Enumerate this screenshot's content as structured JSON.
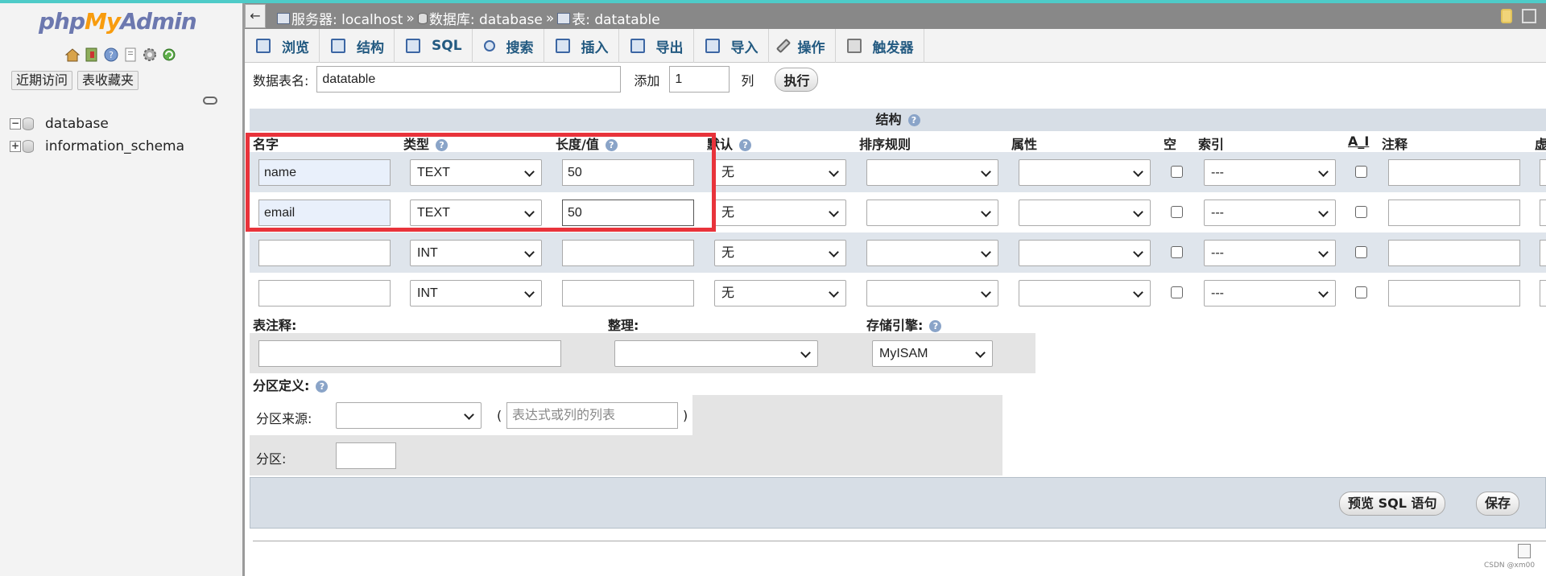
{
  "nav": {
    "logo_php": "php",
    "logo_my": "My",
    "logo_admin": "Admin",
    "icons": [
      "home-icon",
      "exit-icon",
      "help-icon",
      "docs-icon",
      "settings-icon",
      "reload-icon"
    ],
    "recent_label": "近期访问",
    "favorites_label": "表收藏夹",
    "databases": [
      "database",
      "information_schema"
    ]
  },
  "breadcrumb": {
    "back": "←",
    "server": "服务器: localhost",
    "database": "数据库: database",
    "table": "表: datatable",
    "sep": "»"
  },
  "tabs": [
    {
      "label": "浏览",
      "icon": "browse-icon"
    },
    {
      "label": "结构",
      "icon": "structure-icon"
    },
    {
      "label": "SQL",
      "icon": "sql-icon"
    },
    {
      "label": "搜索",
      "icon": "search-icon"
    },
    {
      "label": "插入",
      "icon": "insert-icon"
    },
    {
      "label": "导出",
      "icon": "export-icon"
    },
    {
      "label": "导入",
      "icon": "import-icon"
    },
    {
      "label": "操作",
      "icon": "wrench-icon"
    },
    {
      "label": "触发器",
      "icon": "trigger-icon"
    }
  ],
  "table_form": {
    "name_label": "数据表名:",
    "name_value": "datatable",
    "add_label": "添加",
    "add_value": "1",
    "col_label": "列",
    "go_label": "执行"
  },
  "structure": {
    "caption": "结构",
    "headers": {
      "name": "名字",
      "type": "类型",
      "length": "长度/值",
      "default": "默认",
      "collation": "排序规则",
      "attributes": "属性",
      "null": "空",
      "index": "索引",
      "ai": "A_I",
      "comment": "注释",
      "virtual": "虚"
    },
    "rows": [
      {
        "name": "name",
        "type": "TEXT",
        "length": "50",
        "default": "无",
        "index": "---"
      },
      {
        "name": "email",
        "type": "TEXT",
        "length": "50",
        "default": "无",
        "index": "---"
      },
      {
        "name": "",
        "type": "INT",
        "length": "",
        "default": "无",
        "index": "---"
      },
      {
        "name": "",
        "type": "INT",
        "length": "",
        "default": "无",
        "index": "---"
      }
    ]
  },
  "table_options": {
    "comment_label": "表注释:",
    "collation_label": "整理:",
    "engine_label": "存储引擎:",
    "engine_value": "MyISAM"
  },
  "partition": {
    "label": "分区定义:",
    "source_label": "分区来源:",
    "open_paren": "(",
    "close_paren": ")",
    "expr_placeholder": "表达式或列的列表",
    "partitions_label": "分区:"
  },
  "footer": {
    "preview_label": "预览 SQL 语句",
    "save_label": "保存"
  },
  "watermark": "CSDN @xm00"
}
